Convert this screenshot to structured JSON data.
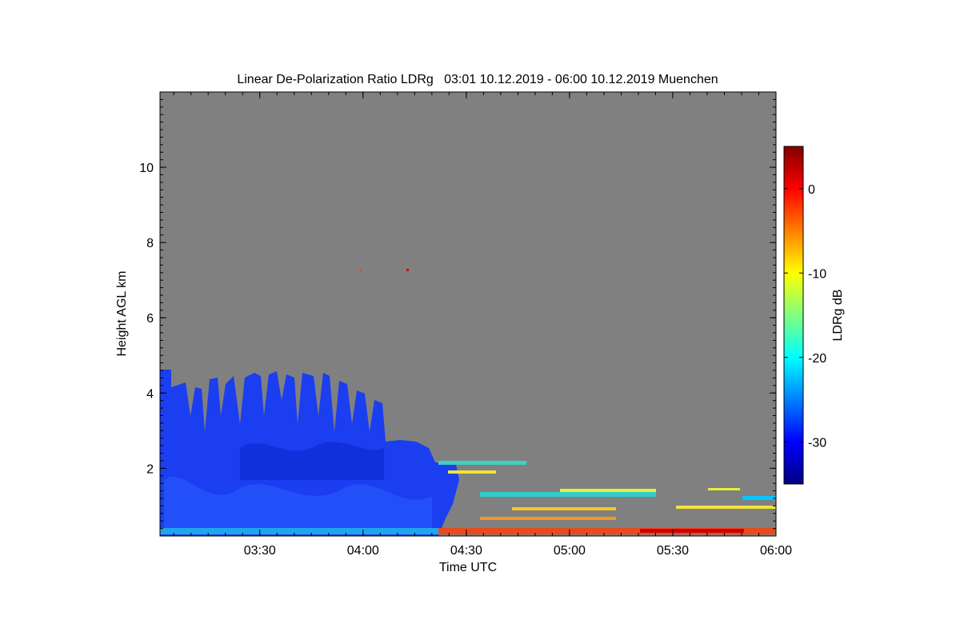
{
  "chart_data": {
    "type": "heatmap",
    "title": "Linear De-Polarization Ratio LDRg   03:01 10.12.2019 - 06:00 10.12.2019 Muenchen",
    "xlabel": "Time UTC",
    "ylabel": "Height AGL km",
    "x_range": [
      "03:01",
      "06:00"
    ],
    "x_ticks": [
      {
        "label": "03:30",
        "minutes": 210
      },
      {
        "label": "04:00",
        "minutes": 240
      },
      {
        "label": "04:30",
        "minutes": 270
      },
      {
        "label": "05:00",
        "minutes": 300
      },
      {
        "label": "05:30",
        "minutes": 330
      },
      {
        "label": "06:00",
        "minutes": 360
      }
    ],
    "ylim": [
      0.2,
      12.0
    ],
    "y_ticks": [
      2,
      4,
      6,
      8,
      10
    ],
    "colorbar": {
      "label": "LDRg dB",
      "range": [
        -35,
        5
      ],
      "ticks": [
        0,
        -10,
        -20,
        -30
      ],
      "colormap": "jet"
    },
    "background_color": "#808080",
    "echo_regions": [
      {
        "start": "03:01",
        "end": "04:20",
        "cloud_top_km": 4.5,
        "ldr_db": -30
      },
      {
        "start": "04:20",
        "end": "04:40",
        "cloud_top_km": 2.2,
        "ldr_db": -28
      },
      {
        "start": "04:30",
        "end": "05:20",
        "height_km": 1.35,
        "ldr_db": -15
      },
      {
        "start": "04:25",
        "end": "06:00",
        "height_km": 0.35,
        "ldr_db": 0
      },
      {
        "start": "05:30",
        "end": "06:00",
        "height_km": 1.2,
        "ldr_db": -10
      }
    ]
  }
}
